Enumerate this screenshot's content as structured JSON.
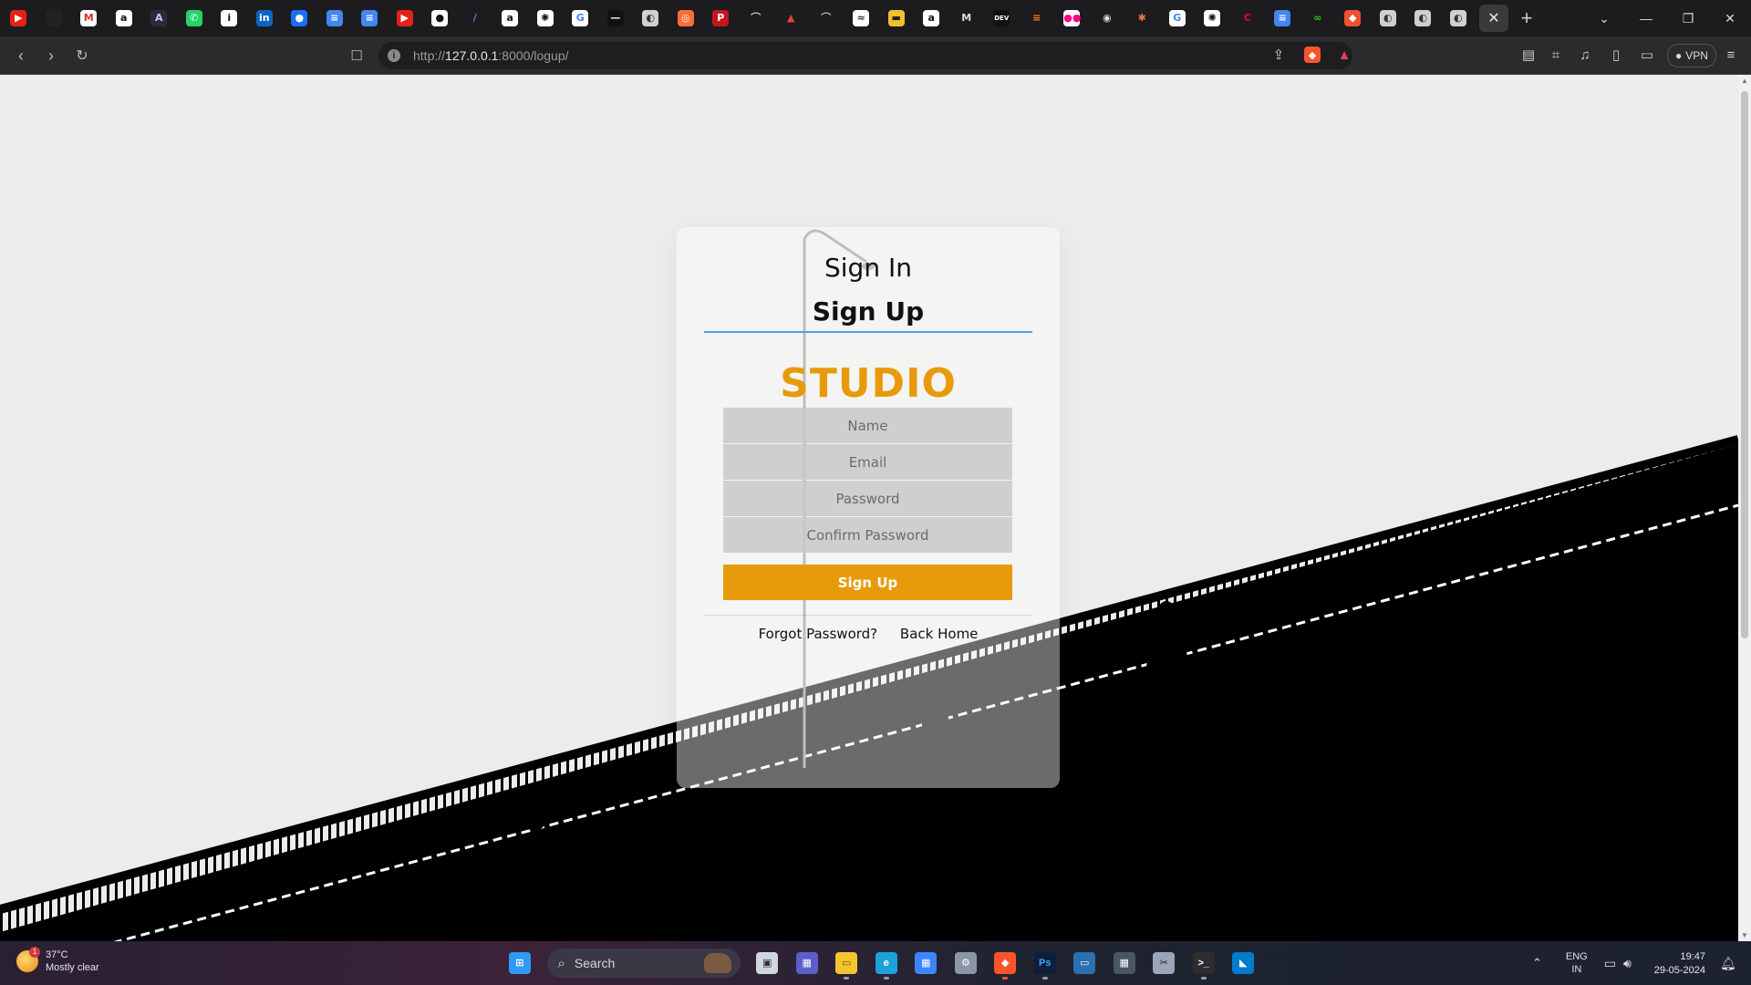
{
  "browser": {
    "address_host": "127.0.0.1",
    "address_prefix": "http://",
    "address_suffix": ":8000/logup/",
    "vpn_label": "VPN",
    "tab_favicons": [
      {
        "name": "youtube-icon",
        "bg": "#e62117",
        "glyph": "▶"
      },
      {
        "name": "black-square-icon",
        "bg": "#222",
        "glyph": ""
      },
      {
        "name": "gmail-icon",
        "bg": "#ffffff",
        "glyph": "M",
        "color": "#d93025"
      },
      {
        "name": "amazon-icon",
        "bg": "#ffffff",
        "glyph": "a",
        "color": "#111"
      },
      {
        "name": "anthropic-icon",
        "bg": "#2b2b3a",
        "glyph": "A",
        "color": "#c9c9ff"
      },
      {
        "name": "whatsapp-icon",
        "bg": "#25d366",
        "glyph": "✆"
      },
      {
        "name": "info-icon",
        "bg": "#ffffff",
        "glyph": "i",
        "color": "#111"
      },
      {
        "name": "linkedin-icon",
        "bg": "#0a66c2",
        "glyph": "in"
      },
      {
        "name": "bluesky-icon",
        "bg": "#1d6ef5",
        "glyph": "●"
      },
      {
        "name": "docs-icon",
        "bg": "#4285f4",
        "glyph": "≡"
      },
      {
        "name": "docs-icon-2",
        "bg": "#4285f4",
        "glyph": "≡"
      },
      {
        "name": "youtube-icon-2",
        "bg": "#e62117",
        "glyph": "▶"
      },
      {
        "name": "github-icon",
        "bg": "#ffffff",
        "glyph": "●",
        "color": "#111"
      },
      {
        "name": "feather-icon",
        "bg": "#1c1c1e",
        "glyph": "/",
        "color": "#3d8bff"
      },
      {
        "name": "amazon-icon-2",
        "bg": "#ffffff",
        "glyph": "a",
        "color": "#111"
      },
      {
        "name": "openai-icon",
        "bg": "#ffffff",
        "glyph": "✺",
        "color": "#111"
      },
      {
        "name": "google-icon",
        "bg": "#ffffff",
        "glyph": "G",
        "color": "#4285f4"
      },
      {
        "name": "dash-icon",
        "bg": "#111",
        "glyph": "—"
      },
      {
        "name": "globe-icon",
        "bg": "#d0d0d0",
        "glyph": "◐",
        "color": "#333"
      },
      {
        "name": "postman-icon",
        "bg": "#ff6c37",
        "glyph": "◎"
      },
      {
        "name": "pdf-icon",
        "bg": "#c4161c",
        "glyph": "P"
      },
      {
        "name": "antenna-icon",
        "bg": "#1c1c1e",
        "glyph": "⌒",
        "color": "#ccc"
      },
      {
        "name": "cloud-red-icon",
        "bg": "#1c1c1e",
        "glyph": "▲",
        "color": "#e2442f"
      },
      {
        "name": "arch-icon",
        "bg": "#1c1c1e",
        "glyph": "⌒",
        "color": "#bbb"
      },
      {
        "name": "chart-icon",
        "bg": "#ffffff",
        "glyph": "≈",
        "color": "#333"
      },
      {
        "name": "wallet-icon",
        "bg": "#f2c12e",
        "glyph": "▬",
        "color": "#222"
      },
      {
        "name": "amazon-icon-3",
        "bg": "#ffffff",
        "glyph": "a",
        "color": "#111"
      },
      {
        "name": "medium-icon",
        "bg": "#1c1c1e",
        "glyph": "M",
        "color": "#ddd"
      },
      {
        "name": "dev-icon",
        "bg": "#111",
        "glyph": "DEV"
      },
      {
        "name": "stack-icon",
        "bg": "#1c1c1e",
        "glyph": "≡",
        "color": "#f48024"
      },
      {
        "name": "flickr-icon",
        "bg": "#ffffff",
        "glyph": "●●",
        "color": "#ff0084"
      },
      {
        "name": "eye-icon",
        "bg": "#1c1c1e",
        "glyph": "◉",
        "color": "#ddd"
      },
      {
        "name": "colors-icon",
        "bg": "#1c1c1e",
        "glyph": "✱",
        "color": "#e74"
      },
      {
        "name": "google-icon-2",
        "bg": "#ffffff",
        "glyph": "G",
        "color": "#4285f4"
      },
      {
        "name": "openai-icon-2",
        "bg": "#ffffff",
        "glyph": "✺",
        "color": "#111"
      },
      {
        "name": "cycle-icon",
        "bg": "#1c1c1e",
        "glyph": "C",
        "color": "#e03"
      },
      {
        "name": "docs-icon-3",
        "bg": "#4285f4",
        "glyph": "≡"
      },
      {
        "name": "dots-icon",
        "bg": "#1c1c1e",
        "glyph": "∞",
        "color": "#3c3"
      },
      {
        "name": "git-icon",
        "bg": "#f05133",
        "glyph": "◆"
      },
      {
        "name": "globe-icon-2",
        "bg": "#d0d0d0",
        "glyph": "◐",
        "color": "#333"
      },
      {
        "name": "globe-icon-3",
        "bg": "#d0d0d0",
        "glyph": "◐",
        "color": "#333"
      },
      {
        "name": "globe-icon-4",
        "bg": "#d0d0d0",
        "glyph": "◐",
        "color": "#333"
      }
    ]
  },
  "form": {
    "tab_sign_in": "Sign In",
    "tab_sign_up": "Sign Up",
    "logo_text": "STUDIO",
    "name_placeholder": "Name",
    "email_placeholder": "Email",
    "password_placeholder": "Password",
    "confirm_placeholder": "Confirm Password",
    "submit_label": "Sign Up",
    "forgot_link": "Forgot Password?",
    "home_link": "Back Home",
    "accent_color": "#e79b0b",
    "underline_color": "#4fa3db"
  },
  "taskbar": {
    "weather_temp": "37°C",
    "weather_desc": "Mostly clear",
    "weather_badge": "1",
    "search_label": "Search",
    "lang_top": "ENG",
    "lang_bottom": "IN",
    "time": "19:47",
    "date": "29-05-2024",
    "apps": [
      {
        "name": "windows-start-icon",
        "bg": "#2e9af5",
        "glyph": "⊞"
      },
      {
        "name": "task-view-icon",
        "bg": "#cfd6df",
        "glyph": "▣",
        "color": "#333"
      },
      {
        "name": "teams-icon",
        "bg": "#5b5fc7",
        "glyph": "▦"
      },
      {
        "name": "file-explorer-icon",
        "bg": "#f4c430",
        "glyph": "▭",
        "color": "#7a5a10"
      },
      {
        "name": "edge-icon",
        "bg": "#1da1d8",
        "glyph": "e"
      },
      {
        "name": "store-icon",
        "bg": "#3a86ff",
        "glyph": "▦"
      },
      {
        "name": "settings-icon",
        "bg": "#8a96a5",
        "glyph": "⚙"
      },
      {
        "name": "brave-icon",
        "bg": "#fb542b",
        "glyph": "◆"
      },
      {
        "name": "photoshop-icon",
        "bg": "#0f1e3a",
        "glyph": "Ps",
        "color": "#31a8ff"
      },
      {
        "name": "remote-desktop-icon",
        "bg": "#2a6fb0",
        "glyph": "▭"
      },
      {
        "name": "calculator-icon",
        "bg": "#4a5566",
        "glyph": "▦"
      },
      {
        "name": "snip-icon",
        "bg": "#9aa6b8",
        "glyph": "✂",
        "color": "#222"
      },
      {
        "name": "terminal-icon",
        "bg": "#2d2d2d",
        "glyph": ">_"
      },
      {
        "name": "vscode-icon",
        "bg": "#007acc",
        "glyph": "◣"
      }
    ]
  }
}
